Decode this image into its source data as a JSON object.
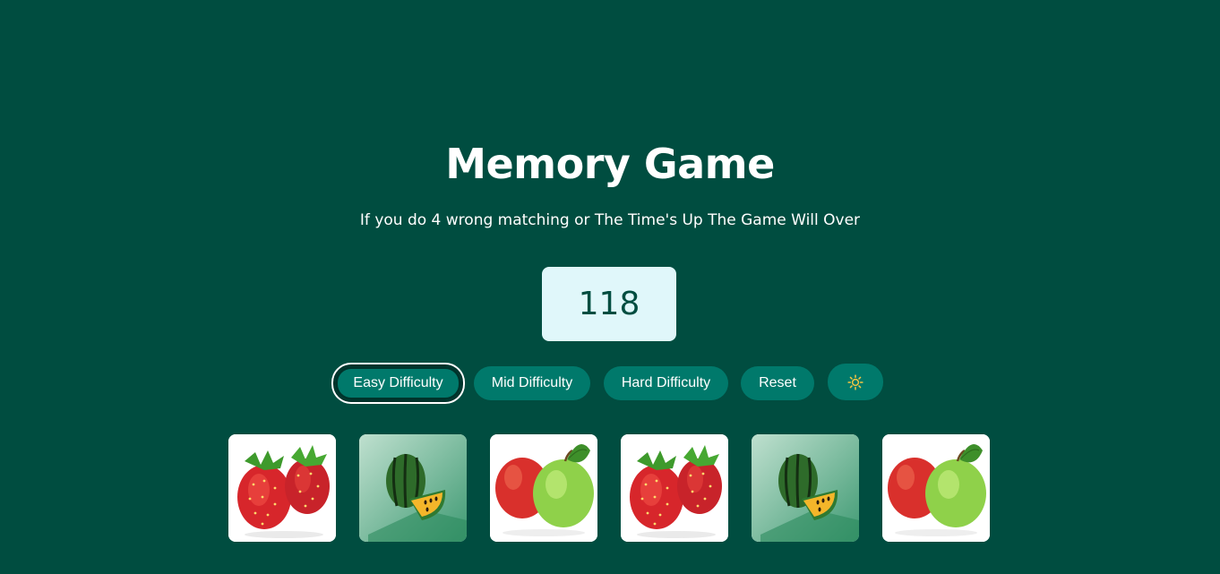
{
  "game": {
    "title": "Memory Game",
    "rules": "If you do 4 wrong matching or The Time's Up The Game Will Over",
    "timer": "118"
  },
  "controls": {
    "easy": "Easy Difficulty",
    "mid": "Mid Difficulty",
    "hard": "Hard Difficulty",
    "reset": "Reset",
    "theme_icon": "sun-icon",
    "active": "easy"
  },
  "cards": [
    {
      "fruit": "strawberry"
    },
    {
      "fruit": "watermelon"
    },
    {
      "fruit": "apple"
    },
    {
      "fruit": "strawberry"
    },
    {
      "fruit": "watermelon"
    },
    {
      "fruit": "apple"
    }
  ],
  "colors": {
    "background": "#004d40",
    "button": "#00796b",
    "timer_bg": "#e0f7fa",
    "timer_text": "#004d40"
  }
}
